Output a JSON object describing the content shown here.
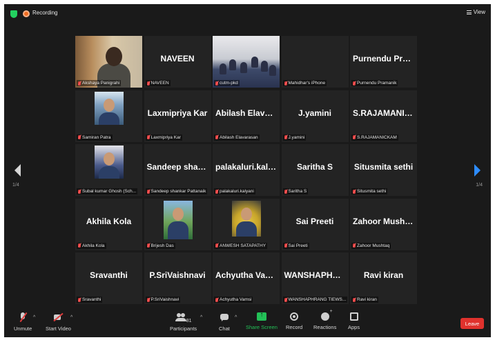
{
  "topbar": {
    "recording_label": "Recording",
    "view_label": "View"
  },
  "participants": [
    {
      "tile_name": "",
      "label": "Akshaya Panigrahi",
      "kind": "video-akshaya",
      "active": true
    },
    {
      "tile_name": "NAVEEN",
      "label": "NAVEEN",
      "kind": "name"
    },
    {
      "tile_name": "",
      "label": "cutm-pkd",
      "kind": "video-cutm"
    },
    {
      "tile_name": "",
      "label": "Mahidhar's iPhone",
      "kind": "blank"
    },
    {
      "tile_name": "Purnendu Pram...",
      "label": "Purnendu Pramanik",
      "kind": "name"
    },
    {
      "tile_name": "",
      "label": "Samiran Patra",
      "kind": "avatar-samiran"
    },
    {
      "tile_name": "Laxmipriya Kar",
      "label": "Laxmipriya Kar",
      "kind": "name"
    },
    {
      "tile_name": "Abilash Elavara...",
      "label": "Abilash Elavarasan",
      "kind": "name"
    },
    {
      "tile_name": "J.yamini",
      "label": "J.yamini",
      "kind": "name"
    },
    {
      "tile_name": "S.RAJAMANICK...",
      "label": "S.RAJAMANICKAM",
      "kind": "name"
    },
    {
      "tile_name": "",
      "label": "Subal kumar Ghosh (Sch...",
      "kind": "avatar-subal"
    },
    {
      "tile_name": "Sandeep shank...",
      "label": "Sandeep shankar Pattanaik",
      "kind": "name"
    },
    {
      "tile_name": "palakaluri.kalyani",
      "label": "palakaluri.kalyani",
      "kind": "name"
    },
    {
      "tile_name": "Saritha S",
      "label": "Saritha S",
      "kind": "name"
    },
    {
      "tile_name": "Situsmita sethi",
      "label": "Situsmita sethi",
      "kind": "name"
    },
    {
      "tile_name": "Akhila Kola",
      "label": "Akhila Kola",
      "kind": "name"
    },
    {
      "tile_name": "",
      "label": "Brijesh Das",
      "kind": "avatar-brijesh"
    },
    {
      "tile_name": "",
      "label": "ANWESH SATAPATHY",
      "kind": "avatar-anwesh"
    },
    {
      "tile_name": "Sai Preeti",
      "label": "Sai Preeti",
      "kind": "name"
    },
    {
      "tile_name": "Zahoor Mushtaq",
      "label": "Zahoor Mushtaq",
      "kind": "name"
    },
    {
      "tile_name": "Sravanthi",
      "label": "Sravanthi",
      "kind": "name"
    },
    {
      "tile_name": "P.SriVaishnavi",
      "label": "P.SriVaishnavi",
      "kind": "name"
    },
    {
      "tile_name": "Achyutha Vamsi",
      "label": "Achyutha Vamsi",
      "kind": "name"
    },
    {
      "tile_name": "WANSHAPHRA...",
      "label": "WANSHAPHRANG TIEWS...",
      "kind": "name"
    },
    {
      "tile_name": "Ravi kiran",
      "label": "Ravi kiran",
      "kind": "name"
    }
  ],
  "pagination": {
    "left": "1/4",
    "right": "1/4"
  },
  "toolbar": {
    "unmute": "Unmute",
    "start_video": "Start Video",
    "participants": "Participants",
    "participants_count": "81",
    "chat": "Chat",
    "share_screen": "Share Screen",
    "record": "Record",
    "reactions": "Reactions",
    "apps": "Apps",
    "leave": "Leave"
  },
  "colors": {
    "accent_green": "#23c157",
    "leave_red": "#e0322d",
    "active_speaker": "#d2e55b",
    "nav_blue": "#2d8cff"
  }
}
